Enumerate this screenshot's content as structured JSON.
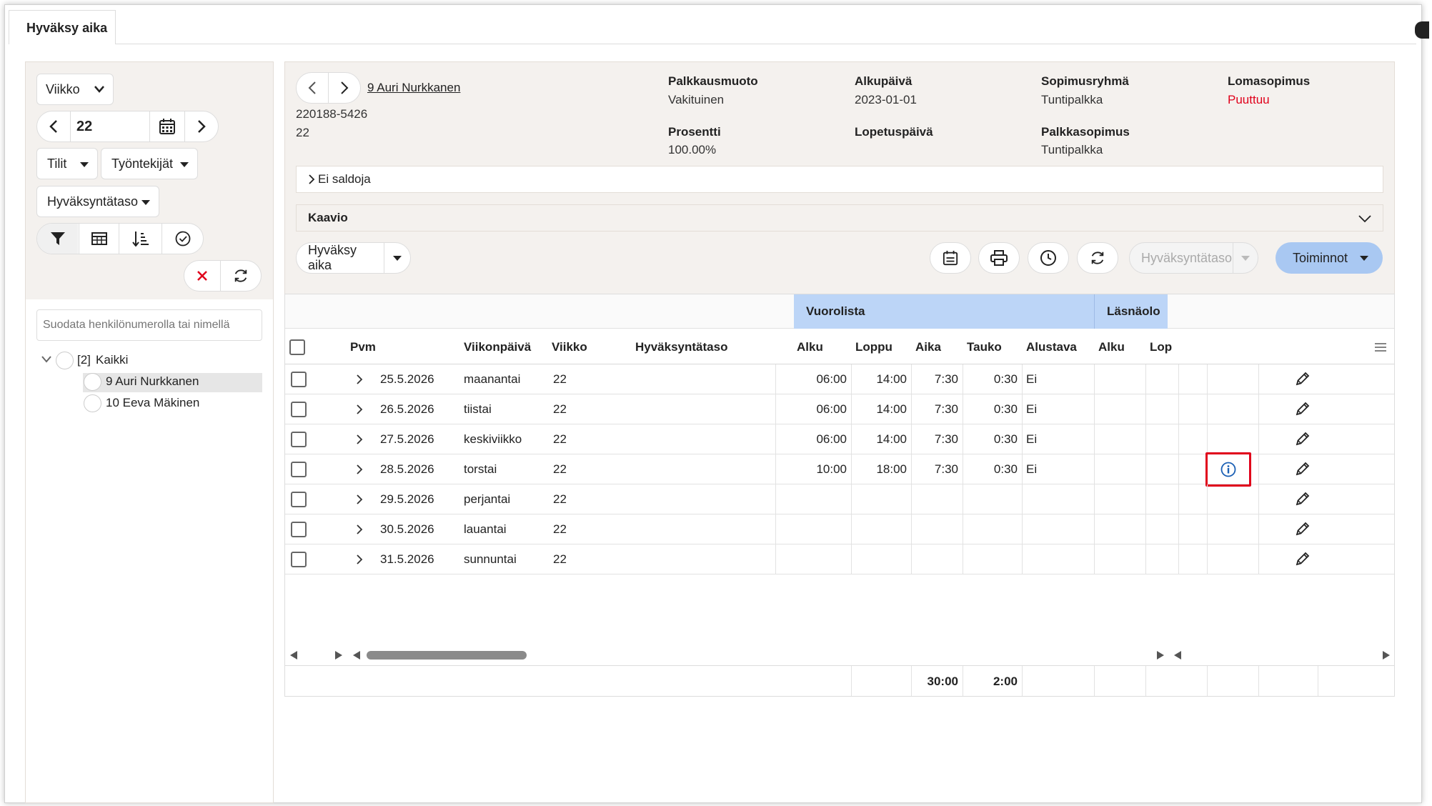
{
  "tab_label": "Hyväksy aika",
  "side": {
    "period_select": "Viikko",
    "week_value": "22",
    "tilit": "Tilit",
    "tyontekijat": "Työntekijät",
    "hyvaksyntataso": "Hyväksyntätaso",
    "filter_placeholder": "Suodata henkilönumerolla tai nimellä",
    "tree": {
      "root_count": "[2]",
      "root_label": "Kaikki",
      "children": [
        "9 Auri Nurkkanen",
        "10 Eeva Mäkinen"
      ]
    }
  },
  "employee": {
    "name_link": "9 Auri Nurkkanen",
    "id": "220188-5426",
    "number": "22",
    "fields": [
      {
        "label": "Palkkausmuoto",
        "value": "Vakituinen"
      },
      {
        "label": "Alkupäivä",
        "value": "2023-01-01"
      },
      {
        "label": "Sopimusryhmä",
        "value": "Tuntipalkka"
      },
      {
        "label": "Lomasopimus",
        "value": "Puuttuu"
      },
      {
        "label": "Prosentti",
        "value": "100.00%"
      },
      {
        "label": "Lopetuspäivä",
        "value": ""
      },
      {
        "label": "Palkkasopimus",
        "value": "Tuntipalkka"
      }
    ],
    "warn_color": "#e0001b"
  },
  "saldot_label": "Ei saldoja",
  "kaavio_label": "Kaavio",
  "toolbar": {
    "hyvaksy": "Hyväksy aika",
    "hyvaksyntataso": "Hyväksyntätaso",
    "toiminnot": "Toiminnot"
  },
  "table": {
    "group_vuorolista": "Vuorolista",
    "group_lasnaolo": "Läsnäolo",
    "headers": {
      "pvm": "Pvm",
      "viikonpaiva": "Viikonpäivä",
      "viikko": "Viikko",
      "hyvaksyntataso": "Hyväksyntätaso",
      "alku": "Alku",
      "loppu": "Loppu",
      "aika": "Aika",
      "tauko": "Tauko",
      "alustava": "Alustava",
      "alku2": "Alku",
      "loppu2": "Lop"
    },
    "rows": [
      {
        "pvm": "25.5.2026",
        "day": "maanantai",
        "week": "22",
        "alku": "06:00",
        "loppu": "14:00",
        "aika": "7:30",
        "tauko": "0:30",
        "alustava": "Ei"
      },
      {
        "pvm": "26.5.2026",
        "day": "tiistai",
        "week": "22",
        "alku": "06:00",
        "loppu": "14:00",
        "aika": "7:30",
        "tauko": "0:30",
        "alustava": "Ei"
      },
      {
        "pvm": "27.5.2026",
        "day": "keskiviikko",
        "week": "22",
        "alku": "06:00",
        "loppu": "14:00",
        "aika": "7:30",
        "tauko": "0:30",
        "alustava": "Ei"
      },
      {
        "pvm": "28.5.2026",
        "day": "torstai",
        "week": "22",
        "alku": "10:00",
        "loppu": "18:00",
        "aika": "7:30",
        "tauko": "0:30",
        "alustava": "Ei",
        "info": true
      },
      {
        "pvm": "29.5.2026",
        "day": "perjantai",
        "week": "22",
        "alku": "",
        "loppu": "",
        "aika": "",
        "tauko": "",
        "alustava": ""
      },
      {
        "pvm": "30.5.2026",
        "day": "lauantai",
        "week": "22",
        "alku": "",
        "loppu": "",
        "aika": "",
        "tauko": "",
        "alustava": ""
      },
      {
        "pvm": "31.5.2026",
        "day": "sunnuntai",
        "week": "22",
        "alku": "",
        "loppu": "",
        "aika": "",
        "tauko": "",
        "alustava": ""
      }
    ],
    "totals": {
      "aika": "30:00",
      "tauko": "2:00"
    }
  },
  "colors": {
    "group_header": "#bcd5f7",
    "primary_button": "#a9c8f2",
    "highlight": "#e0001b",
    "info_icon": "#1a5fb4"
  }
}
